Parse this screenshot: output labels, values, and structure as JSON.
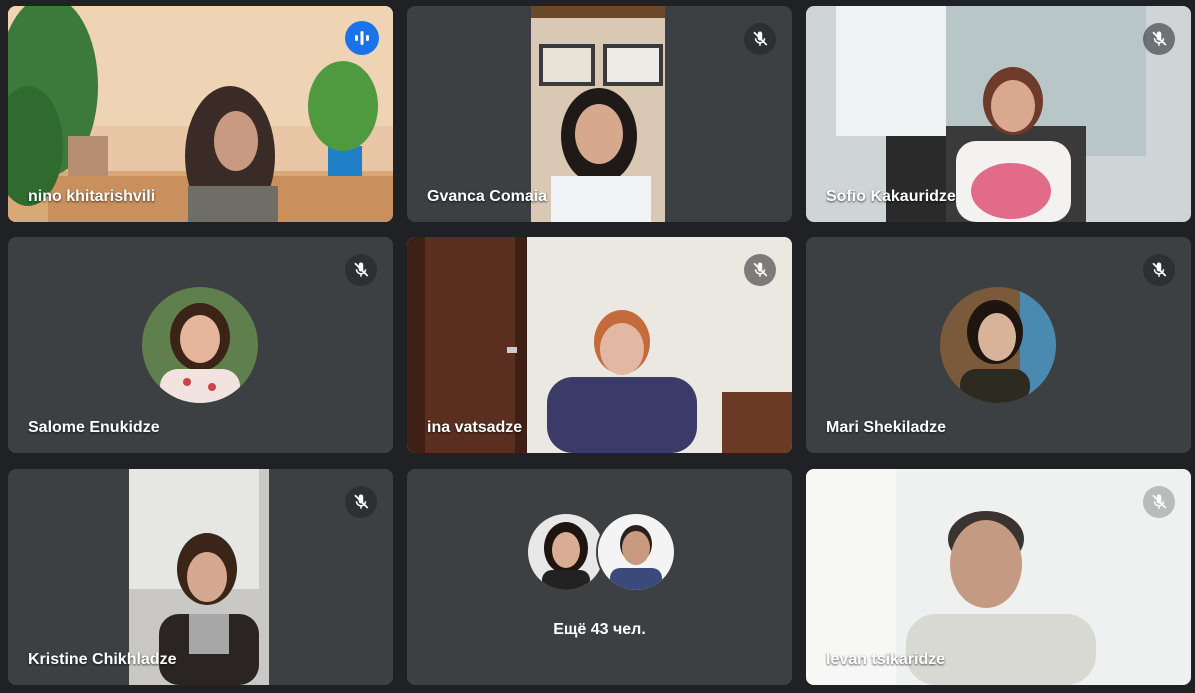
{
  "participants": [
    {
      "name": "nino khitarishvili",
      "status": "speaking"
    },
    {
      "name": "Gvanca Comaia",
      "status": "muted"
    },
    {
      "name": "Sofio Kakauridze",
      "status": "muted"
    },
    {
      "name": "Salome Enukidze",
      "status": "muted"
    },
    {
      "name": "ina vatsadze",
      "status": "muted"
    },
    {
      "name": "Mari Shekiladze",
      "status": "muted"
    },
    {
      "name": "Kristine Chikhladze",
      "status": "muted"
    },
    {
      "name": "levan tsikaridze",
      "status": "muted"
    }
  ],
  "more_tile": {
    "label": "Ещё 43 чел."
  },
  "icons": {
    "muted": "mic-off-icon",
    "speaking": "audio-level-icon"
  },
  "colors": {
    "background": "#202124",
    "tile": "#3c4043",
    "active_border": "#8ab4f8",
    "speaking_badge": "#1a73e8"
  }
}
